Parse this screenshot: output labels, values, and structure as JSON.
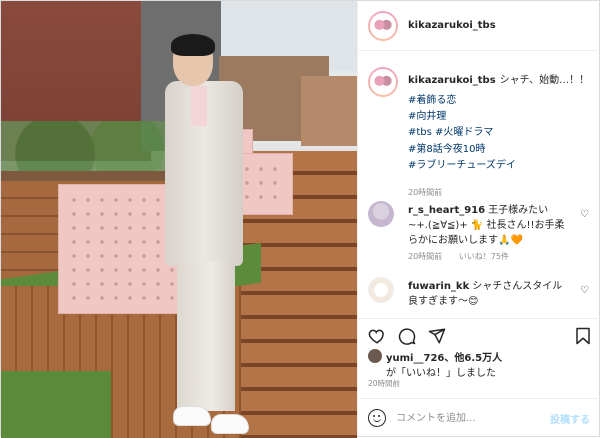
{
  "header": {
    "username": "kikazarukoi_tbs"
  },
  "caption": {
    "username": "kikazarukoi_tbs",
    "text": "シャチ、始動…！！",
    "tags": [
      "#着飾る恋",
      "#向井理",
      "#tbs #火曜ドラマ",
      "#第8話今夜10時",
      "#ラブリーチューズデイ"
    ],
    "time": "20時間前"
  },
  "comments": [
    {
      "username": "r_s_heart_916",
      "text": "王子様みたい~+.(≧∀≦)+ 🐈 社長さん!!お手柔らかにお願いします🙏🧡",
      "meta_time": "20時間前",
      "meta_likes": "いいね！75件"
    },
    {
      "username": "fuwarin_kk",
      "text": "シャチさんスタイル良すぎます〜😊"
    }
  ],
  "likes": {
    "line1_user": "yumi__726",
    "line1_rest": "、他6.5万人",
    "line2": "が「いいね！」しました"
  },
  "post_time": "20時間前",
  "comment_box": {
    "placeholder": "コメントを追加...",
    "post_label": "投稿する"
  },
  "icons": {
    "like": "heart-icon",
    "comment": "comment-icon",
    "share": "share-icon",
    "save": "bookmark-icon"
  }
}
